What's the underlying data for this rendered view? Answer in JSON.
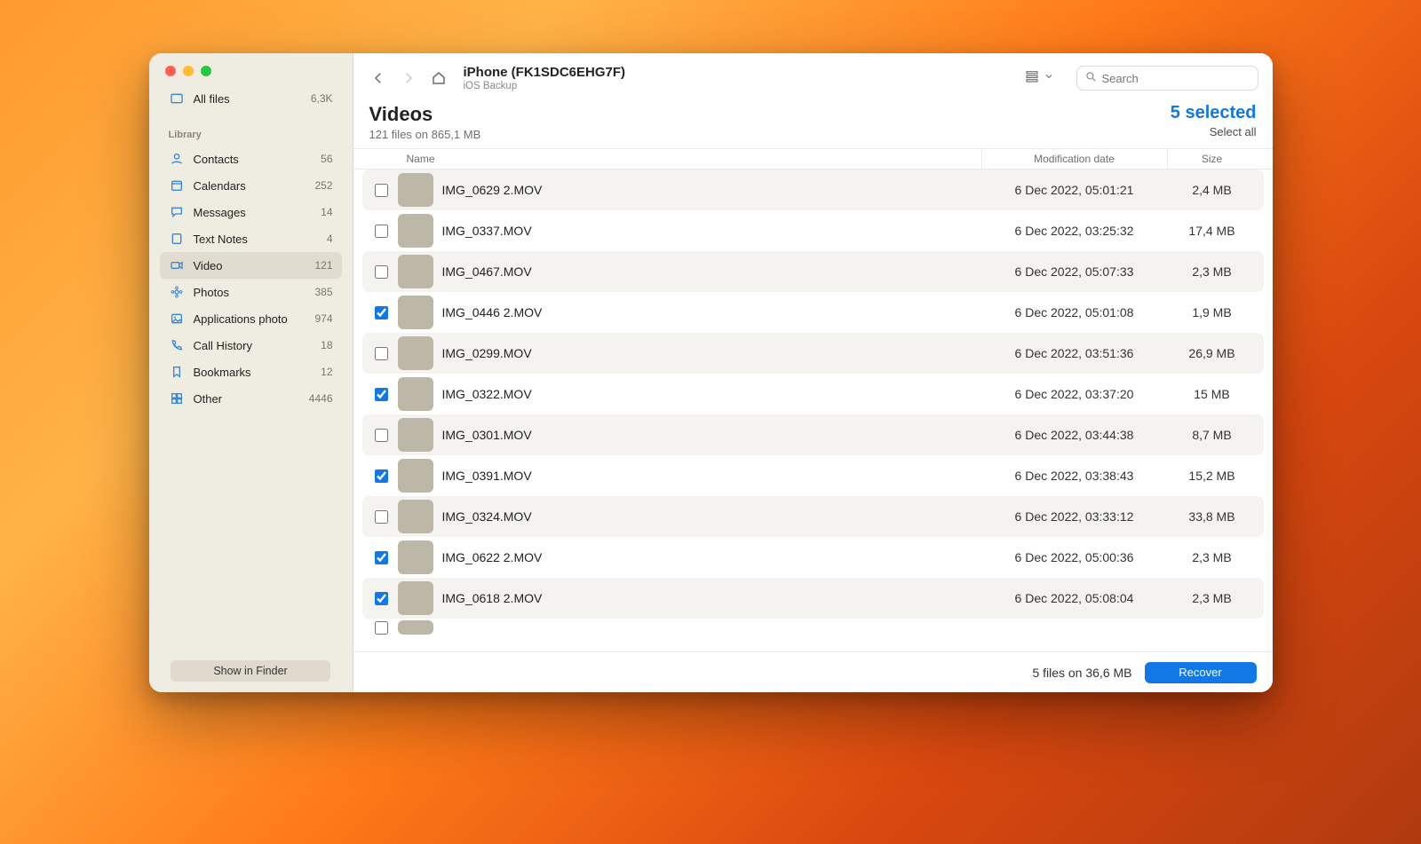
{
  "sidebar": {
    "top": {
      "label": "All files",
      "count": "6,3K"
    },
    "library_header": "Library",
    "items": [
      {
        "label": "Contacts",
        "count": "56"
      },
      {
        "label": "Calendars",
        "count": "252"
      },
      {
        "label": "Messages",
        "count": "14"
      },
      {
        "label": "Text Notes",
        "count": "4"
      },
      {
        "label": "Video",
        "count": "121"
      },
      {
        "label": "Photos",
        "count": "385"
      },
      {
        "label": "Applications photo",
        "count": "974"
      },
      {
        "label": "Call History",
        "count": "18"
      },
      {
        "label": "Bookmarks",
        "count": "12"
      },
      {
        "label": "Other",
        "count": "4446"
      }
    ],
    "show_in_finder": "Show in Finder"
  },
  "header": {
    "device_title": "iPhone (FK1SDC6EHG7F)",
    "device_subtitle": "iOS Backup",
    "search_placeholder": "Search"
  },
  "content": {
    "title": "Videos",
    "subtitle": "121 files on 865,1 MB",
    "selected_text": "5 selected",
    "select_all": "Select all"
  },
  "columns": {
    "name": "Name",
    "mod": "Modification date",
    "size": "Size"
  },
  "rows": [
    {
      "checked": false,
      "name": "IMG_0629 2.MOV",
      "mod": "6 Dec 2022, 05:01:21",
      "size": "2,4 MB"
    },
    {
      "checked": false,
      "name": "IMG_0337.MOV",
      "mod": "6 Dec 2022, 03:25:32",
      "size": "17,4 MB"
    },
    {
      "checked": false,
      "name": "IMG_0467.MOV",
      "mod": "6 Dec 2022, 05:07:33",
      "size": "2,3 MB"
    },
    {
      "checked": true,
      "name": "IMG_0446 2.MOV",
      "mod": "6 Dec 2022, 05:01:08",
      "size": "1,9 MB"
    },
    {
      "checked": false,
      "name": "IMG_0299.MOV",
      "mod": "6 Dec 2022, 03:51:36",
      "size": "26,9 MB"
    },
    {
      "checked": true,
      "name": "IMG_0322.MOV",
      "mod": "6 Dec 2022, 03:37:20",
      "size": "15 MB"
    },
    {
      "checked": false,
      "name": "IMG_0301.MOV",
      "mod": "6 Dec 2022, 03:44:38",
      "size": "8,7 MB"
    },
    {
      "checked": true,
      "name": "IMG_0391.MOV",
      "mod": "6 Dec 2022, 03:38:43",
      "size": "15,2 MB"
    },
    {
      "checked": false,
      "name": "IMG_0324.MOV",
      "mod": "6 Dec 2022, 03:33:12",
      "size": "33,8 MB"
    },
    {
      "checked": true,
      "name": "IMG_0622 2.MOV",
      "mod": "6 Dec 2022, 05:00:36",
      "size": "2,3 MB"
    },
    {
      "checked": true,
      "name": "IMG_0618 2.MOV",
      "mod": "6 Dec 2022, 05:08:04",
      "size": "2,3 MB"
    }
  ],
  "footer": {
    "summary": "5 files on 36,6 MB",
    "recover": "Recover"
  }
}
